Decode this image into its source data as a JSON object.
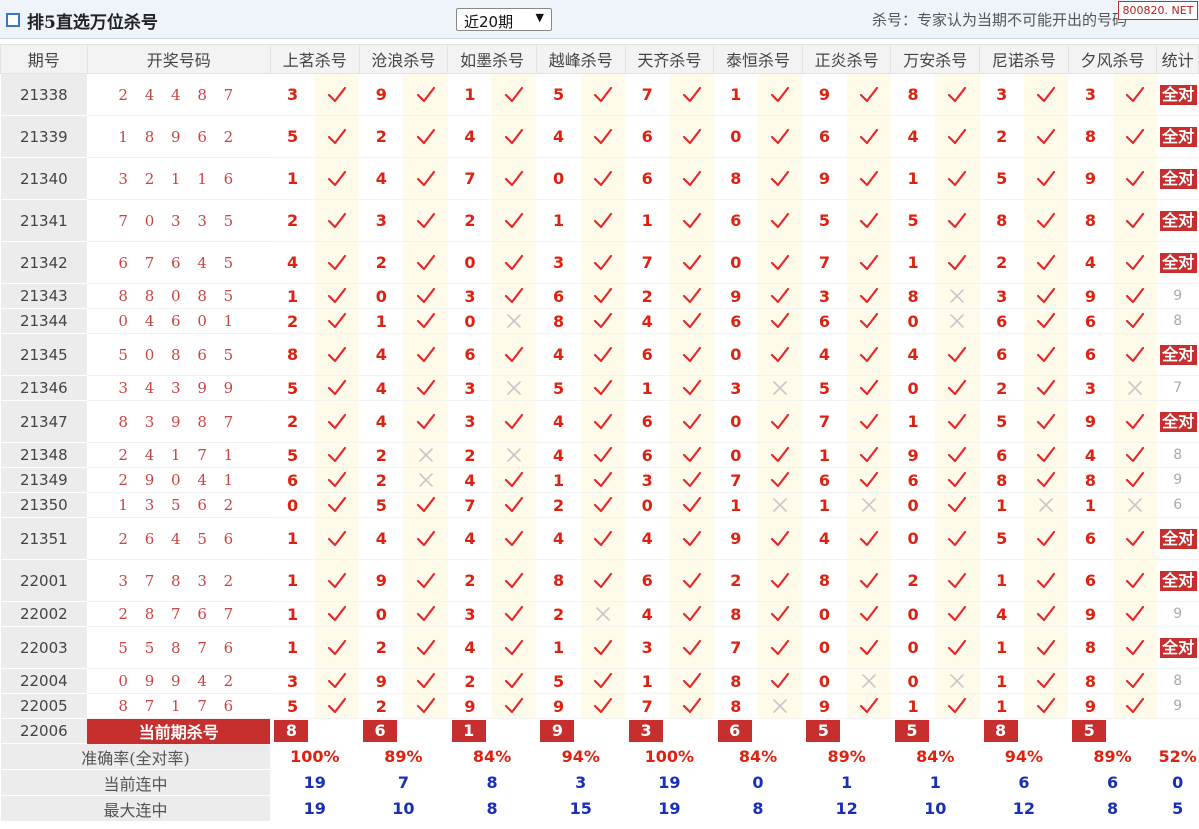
{
  "header": {
    "title": "排5直选万位杀号",
    "period_selected": "近20期",
    "description": "杀号：专家认为当期不可能开出的号码",
    "site_badge": "800820. NET"
  },
  "columns": {
    "period": "期号",
    "draw": "开奖号码",
    "experts": [
      "上茗杀号",
      "沧浪杀号",
      "如墨杀号",
      "越峰杀号",
      "天齐杀号",
      "泰恒杀号",
      "正炎杀号",
      "万安杀号",
      "尼诺杀号",
      "夕风杀号"
    ],
    "total": "统计"
  },
  "rows": [
    {
      "period": "21338",
      "draw": "2 4 4 8 7",
      "kills": [
        3,
        9,
        1,
        5,
        7,
        1,
        9,
        8,
        3,
        3
      ],
      "hits": [
        1,
        1,
        1,
        1,
        1,
        1,
        1,
        1,
        1,
        1
      ],
      "stat": "全对",
      "tall": true
    },
    {
      "period": "21339",
      "draw": "1 8 9 6 2",
      "kills": [
        5,
        2,
        4,
        4,
        6,
        0,
        6,
        4,
        2,
        8
      ],
      "hits": [
        1,
        1,
        1,
        1,
        1,
        1,
        1,
        1,
        1,
        1
      ],
      "stat": "全对",
      "tall": true
    },
    {
      "period": "21340",
      "draw": "3 2 1 1 6",
      "kills": [
        1,
        4,
        7,
        0,
        6,
        8,
        9,
        1,
        5,
        9
      ],
      "hits": [
        1,
        1,
        1,
        1,
        1,
        1,
        1,
        1,
        1,
        1
      ],
      "stat": "全对",
      "tall": true
    },
    {
      "period": "21341",
      "draw": "7 0 3 3 5",
      "kills": [
        2,
        3,
        2,
        1,
        1,
        6,
        5,
        5,
        8,
        8
      ],
      "hits": [
        1,
        1,
        1,
        1,
        1,
        1,
        1,
        1,
        1,
        1
      ],
      "stat": "全对",
      "tall": true
    },
    {
      "period": "21342",
      "draw": "6 7 6 4 5",
      "kills": [
        4,
        2,
        0,
        3,
        7,
        0,
        7,
        1,
        2,
        4
      ],
      "hits": [
        1,
        1,
        1,
        1,
        1,
        1,
        1,
        1,
        1,
        1
      ],
      "stat": "全对",
      "tall": true
    },
    {
      "period": "21343",
      "draw": "8 8 0 8 5",
      "kills": [
        1,
        0,
        3,
        6,
        2,
        9,
        3,
        8,
        3,
        9
      ],
      "hits": [
        1,
        1,
        1,
        1,
        1,
        1,
        1,
        0,
        1,
        1
      ],
      "stat": "9",
      "tall": false
    },
    {
      "period": "21344",
      "draw": "0 4 6 0 1",
      "kills": [
        2,
        1,
        0,
        8,
        4,
        6,
        6,
        0,
        6,
        6
      ],
      "hits": [
        1,
        1,
        0,
        1,
        1,
        1,
        1,
        0,
        1,
        1
      ],
      "stat": "8",
      "tall": false
    },
    {
      "period": "21345",
      "draw": "5 0 8 6 5",
      "kills": [
        8,
        4,
        6,
        4,
        6,
        0,
        4,
        4,
        6,
        6
      ],
      "hits": [
        1,
        1,
        1,
        1,
        1,
        1,
        1,
        1,
        1,
        1
      ],
      "stat": "全对",
      "tall": true
    },
    {
      "period": "21346",
      "draw": "3 4 3 9 9",
      "kills": [
        5,
        4,
        3,
        5,
        1,
        3,
        5,
        0,
        2,
        3
      ],
      "hits": [
        1,
        1,
        0,
        1,
        1,
        0,
        1,
        1,
        1,
        0
      ],
      "stat": "7",
      "tall": false
    },
    {
      "period": "21347",
      "draw": "8 3 9 8 7",
      "kills": [
        2,
        4,
        3,
        4,
        6,
        0,
        7,
        1,
        5,
        9
      ],
      "hits": [
        1,
        1,
        1,
        1,
        1,
        1,
        1,
        1,
        1,
        1
      ],
      "stat": "全对",
      "tall": true
    },
    {
      "period": "21348",
      "draw": "2 4 1 7 1",
      "kills": [
        5,
        2,
        2,
        4,
        6,
        0,
        1,
        9,
        6,
        4
      ],
      "hits": [
        1,
        0,
        0,
        1,
        1,
        1,
        1,
        1,
        1,
        1
      ],
      "stat": "8",
      "tall": false
    },
    {
      "period": "21349",
      "draw": "2 9 0 4 1",
      "kills": [
        6,
        2,
        4,
        1,
        3,
        7,
        6,
        6,
        8,
        8
      ],
      "hits": [
        1,
        0,
        1,
        1,
        1,
        1,
        1,
        1,
        1,
        1
      ],
      "stat": "9",
      "tall": false
    },
    {
      "period": "21350",
      "draw": "1 3 5 6 2",
      "kills": [
        0,
        5,
        7,
        2,
        0,
        1,
        1,
        0,
        1,
        1
      ],
      "hits": [
        1,
        1,
        1,
        1,
        1,
        0,
        0,
        1,
        0,
        0
      ],
      "stat": "6",
      "tall": false
    },
    {
      "period": "21351",
      "draw": "2 6 4 5 6",
      "kills": [
        1,
        4,
        4,
        4,
        4,
        9,
        4,
        0,
        5,
        6
      ],
      "hits": [
        1,
        1,
        1,
        1,
        1,
        1,
        1,
        1,
        1,
        1
      ],
      "stat": "全对",
      "tall": true
    },
    {
      "period": "22001",
      "draw": "3 7 8 3 2",
      "kills": [
        1,
        9,
        2,
        8,
        6,
        2,
        8,
        2,
        1,
        6
      ],
      "hits": [
        1,
        1,
        1,
        1,
        1,
        1,
        1,
        1,
        1,
        1
      ],
      "stat": "全对",
      "tall": true
    },
    {
      "period": "22002",
      "draw": "2 8 7 6 7",
      "kills": [
        1,
        0,
        3,
        2,
        4,
        8,
        0,
        0,
        4,
        9
      ],
      "hits": [
        1,
        1,
        1,
        0,
        1,
        1,
        1,
        1,
        1,
        1
      ],
      "stat": "9",
      "tall": false
    },
    {
      "period": "22003",
      "draw": "5 5 8 7 6",
      "kills": [
        1,
        2,
        4,
        1,
        3,
        7,
        0,
        0,
        1,
        8
      ],
      "hits": [
        1,
        1,
        1,
        1,
        1,
        1,
        1,
        1,
        1,
        1
      ],
      "stat": "全对",
      "tall": true
    },
    {
      "period": "22004",
      "draw": "0 9 9 4 2",
      "kills": [
        3,
        9,
        2,
        5,
        1,
        8,
        0,
        0,
        1,
        8
      ],
      "hits": [
        1,
        1,
        1,
        1,
        1,
        1,
        0,
        0,
        1,
        1
      ],
      "stat": "8",
      "tall": false
    },
    {
      "period": "22005",
      "draw": "8 7 1 7 6",
      "kills": [
        5,
        2,
        9,
        9,
        7,
        8,
        9,
        1,
        1,
        9
      ],
      "hits": [
        1,
        1,
        1,
        1,
        1,
        0,
        1,
        1,
        1,
        1
      ],
      "stat": "9",
      "tall": false
    }
  ],
  "current": {
    "period": "22006",
    "label": "当前期杀号",
    "kills": [
      8,
      6,
      1,
      9,
      3,
      6,
      5,
      5,
      8,
      5
    ]
  },
  "summary": {
    "accuracy_label": "准确率(全对率)",
    "accuracy": [
      "100%",
      "89%",
      "84%",
      "94%",
      "100%",
      "84%",
      "89%",
      "84%",
      "94%",
      "89%"
    ],
    "accuracy_total": "52%",
    "streak_label": "当前连中",
    "streak": [
      "19",
      "7",
      "8",
      "3",
      "19",
      "0",
      "1",
      "1",
      "6",
      "6"
    ],
    "streak_total": "0",
    "max_label": "最大连中",
    "max": [
      "19",
      "10",
      "8",
      "15",
      "19",
      "8",
      "12",
      "10",
      "12",
      "8"
    ],
    "max_total": "5"
  },
  "colors": {
    "hit": "#e8282a",
    "miss": "#c8c8c8",
    "kill": "#d21",
    "accent": "#c72e2e",
    "blue": "#1a2fb8"
  }
}
